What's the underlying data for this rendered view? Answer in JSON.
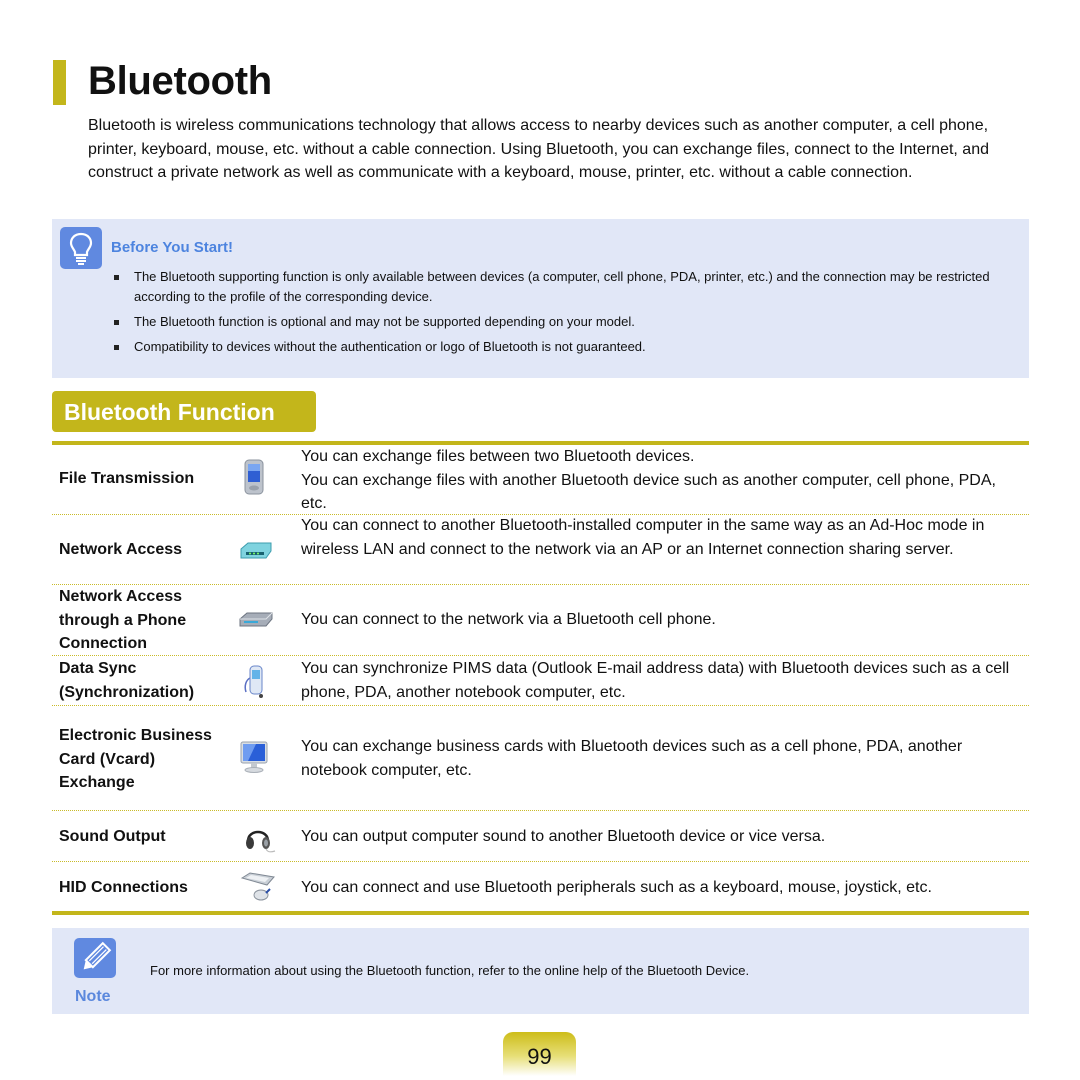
{
  "page": {
    "title": "Bluetooth",
    "intro": "Bluetooth is wireless communications technology that allows access to nearby devices such as another computer, a cell phone, printer, keyboard, mouse, etc. without a cable connection. Using Bluetooth, you can exchange files, connect to the Internet, and construct a private network as well as communicate with a keyboard, mouse, printer, etc. without a cable connection."
  },
  "before_you_start": {
    "icon": "lightbulb-icon",
    "title": "Before You Start!",
    "items": [
      "The Bluetooth supporting function is only available between devices (a computer, cell phone, PDA, printer, etc.) and the connection may be restricted according to the profile of the corresponding device.",
      "The Bluetooth function is optional and may not be supported depending on your model.",
      "Compatibility to devices without the authentication or logo of Bluetooth is not guaranteed."
    ]
  },
  "section": {
    "title": "Bluetooth Function",
    "colors": {
      "accent": "#c3b61b",
      "info_bg": "#e1e7f7",
      "info_title": "#4d84df",
      "icon_bg": "#6089e0"
    },
    "rows": [
      {
        "label": "File Transmission",
        "icon": "pda-icon",
        "desc": [
          "You can exchange files between two Bluetooth devices.",
          "You can exchange files with another Bluetooth device such as another computer, cell phone, PDA, etc."
        ]
      },
      {
        "label": "Network Access",
        "icon": "router-icon",
        "desc": [
          "You can connect to another Bluetooth-installed computer in the same way as an Ad-Hoc mode in wireless LAN and connect to the network via an AP or an Internet connection sharing server."
        ]
      },
      {
        "label": "Network Access through a Phone Connection",
        "icon": "modem-icon",
        "desc": [
          "You can connect to the network via a Bluetooth cell phone."
        ]
      },
      {
        "label": "Data Sync (Synchronization)",
        "icon": "cell-phone-icon",
        "desc": [
          "You can synchronize PIMS data (Outlook E-mail address data) with Bluetooth devices such as a cell phone, PDA, another notebook computer, etc."
        ]
      },
      {
        "label": "Electronic Business Card (Vcard) Exchange",
        "icon": "monitor-icon",
        "desc": [
          "You can exchange business cards with Bluetooth devices such as a cell phone, PDA, another notebook computer, etc."
        ]
      },
      {
        "label": "Sound Output",
        "icon": "headphones-icon",
        "desc": [
          "You can output computer sound to another Bluetooth device or vice versa."
        ]
      },
      {
        "label": "HID Connections",
        "icon": "keyboard-mouse-icon",
        "desc": [
          "You can connect and use Bluetooth peripherals such as a keyboard, mouse, joystick, etc."
        ]
      }
    ]
  },
  "note": {
    "icon": "pencil-icon",
    "label": "Note",
    "text": "For more information about using the Bluetooth function, refer to the online help of the Bluetooth Device."
  },
  "footer": {
    "page_number": "99"
  }
}
